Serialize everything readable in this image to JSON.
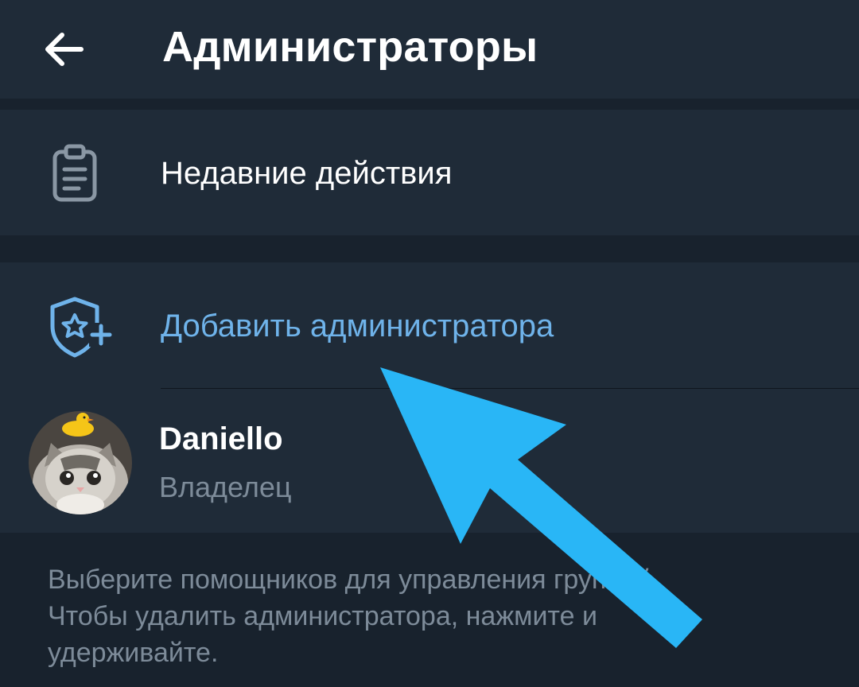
{
  "header": {
    "title": "Администраторы",
    "back_icon": "arrow-left-icon"
  },
  "recent_actions": {
    "label": "Недавние действия",
    "icon": "clipboard-list-icon"
  },
  "add_admin": {
    "label": "Добавить администратора",
    "icon": "shield-star-plus-icon"
  },
  "owner": {
    "name": "Daniello",
    "role": "Владелец",
    "avatar": "cat-with-duck-avatar"
  },
  "footer": {
    "line1": "Выберите помощников для управления группой.",
    "line2": "Чтобы удалить администратора, нажмите и",
    "line3": "удерживайте."
  },
  "annotation": {
    "icon": "pointer-arrow",
    "color": "#29b6f6"
  },
  "colors": {
    "accent": "#6fb3ea",
    "header_bg": "#1f2b38",
    "page_bg": "#18222d"
  }
}
